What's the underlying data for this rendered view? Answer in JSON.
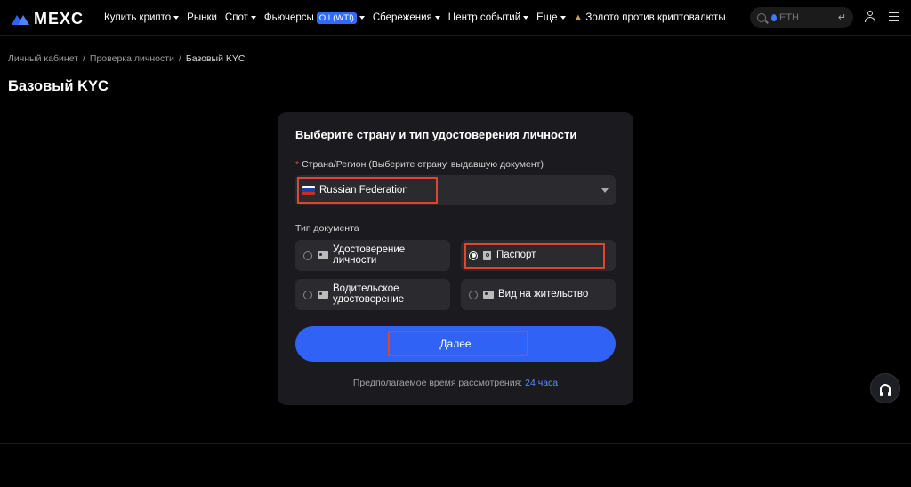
{
  "header": {
    "logo": "MEXC",
    "nav": [
      {
        "label": "Купить крипто",
        "dropdown": true
      },
      {
        "label": "Рынки",
        "dropdown": false
      },
      {
        "label": "Спот",
        "dropdown": true
      },
      {
        "label": "Фьючерсы",
        "badge": "OIL(WTI)",
        "dropdown": true
      },
      {
        "label": "Сбережения",
        "dropdown": true
      },
      {
        "label": "Центр событий",
        "dropdown": true
      },
      {
        "label": "Еще",
        "dropdown": true
      },
      {
        "label": "Золото против криптовалюты",
        "dropdown": false
      }
    ],
    "search": {
      "placeholder": "ETH",
      "enter_symbol": "↵"
    }
  },
  "breadcrumb": [
    "Личный кабинет",
    "Проверка личности",
    "Базовый KYC"
  ],
  "page_title": "Базовый KYC",
  "card": {
    "title": "Выберите страну и тип удостоверения личности",
    "country_label": "Страна/Регион (Выберите страну, выдавшую документ)",
    "required_mark": "*",
    "country_value": "Russian Federation",
    "doc_type_label": "Тип документа",
    "options": [
      {
        "label": "Удостоверение личности",
        "selected": false,
        "icon": "id-card-icon"
      },
      {
        "label": "Паспорт",
        "selected": true,
        "icon": "passport-icon"
      },
      {
        "label": "Водительское удостоверение",
        "selected": false,
        "icon": "driver-license-icon"
      },
      {
        "label": "Вид на жительство",
        "selected": false,
        "icon": "residence-permit-icon"
      }
    ],
    "next_button": "Далее",
    "eta_text": "Предполагаемое время рассмотрения:",
    "eta_time": "24 часа"
  },
  "colors": {
    "accent": "#2f62f5",
    "highlight": "#e0452f",
    "background": "#000000",
    "card": "#1b1b1f"
  }
}
